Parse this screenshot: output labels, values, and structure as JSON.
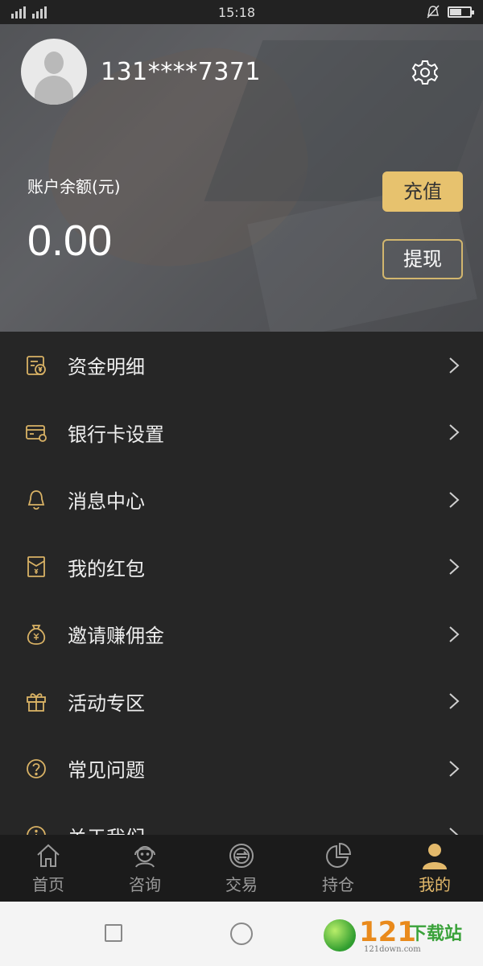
{
  "status_bar": {
    "time": "15:18",
    "battery_level": 0.55
  },
  "profile": {
    "phone": "131****7371"
  },
  "account": {
    "balance_label": "账户余额(元)",
    "balance_value": "0.00",
    "recharge_label": "充值",
    "withdraw_label": "提现",
    "accent_color": "#e7c26e"
  },
  "menu": {
    "items": [
      {
        "label": "资金明细",
        "icon": "fund-detail-icon"
      },
      {
        "label": "银行卡设置",
        "icon": "bank-card-icon"
      },
      {
        "label": "消息中心",
        "icon": "bell-icon"
      },
      {
        "label": "我的红包",
        "icon": "red-envelope-icon"
      },
      {
        "label": "邀请赚佣金",
        "icon": "money-bag-icon"
      },
      {
        "label": "活动专区",
        "icon": "gift-icon"
      },
      {
        "label": "常见问题",
        "icon": "question-icon"
      },
      {
        "label": "关于我们",
        "icon": "info-icon"
      }
    ]
  },
  "tabbar": {
    "tabs": [
      {
        "label": "首页",
        "icon": "home-icon"
      },
      {
        "label": "咨询",
        "icon": "support-agent-icon"
      },
      {
        "label": "交易",
        "icon": "exchange-icon"
      },
      {
        "label": "持仓",
        "icon": "pie-chart-icon"
      },
      {
        "label": "我的",
        "icon": "user-icon"
      }
    ],
    "active_index": 4,
    "active_color": "#e3b96b"
  },
  "watermark": {
    "number": "121",
    "text": "下载站",
    "sub": "121down.com"
  }
}
